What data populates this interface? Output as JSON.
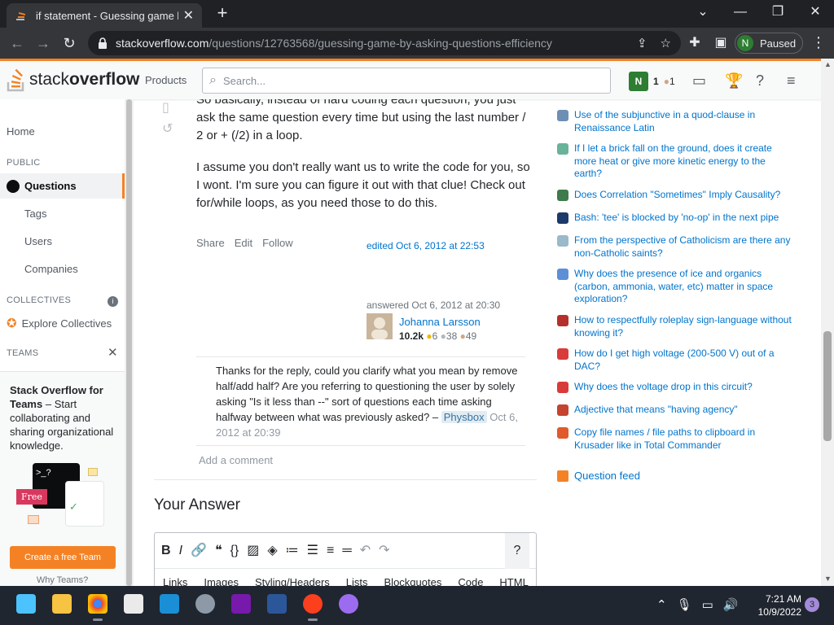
{
  "browser": {
    "tab_title": "if statement - Guessing game by",
    "url_host": "stackoverflow.com",
    "url_path": "/questions/12763568/guessing-game-by-asking-questions-efficiency",
    "profile_initial": "N",
    "profile_status": "Paused"
  },
  "so_header": {
    "logo_light": "stack",
    "logo_bold": "overflow",
    "products": "Products",
    "search_placeholder": "Search...",
    "user_initial": "N",
    "reputation": "1",
    "bronze": "1"
  },
  "leftnav": {
    "home": "Home",
    "public": "PUBLIC",
    "questions": "Questions",
    "tags": "Tags",
    "users": "Users",
    "companies": "Companies",
    "collectives": "COLLECTIVES",
    "explore_collectives": "Explore Collectives",
    "teams": "TEAMS",
    "teams_title": "Stack Overflow for Teams",
    "teams_desc": " – Start collaborating and sharing organizational knowledge.",
    "free_badge": "Free",
    "create_team": "Create a free Team",
    "why_teams": "Why Teams?"
  },
  "answer": {
    "para1": "So basically, instead of hard coding each question, you just ask the same question every time but using the last number / 2 or + (/2) in a loop.",
    "para2": "I assume you don't really want us to write the code for you, so I wont. I'm sure you can figure it out with that clue! Check out for/while loops, as you need those to do this.",
    "share": "Share",
    "edit": "Edit",
    "follow": "Follow",
    "edited": "edited Oct 6, 2012 at 22:53",
    "answered": "answered Oct 6, 2012 at 20:30",
    "user_name": "Johanna Larsson",
    "user_rep": "10.2k",
    "gold": "6",
    "silver": "38",
    "bronze": "49"
  },
  "comment": {
    "text": "Thanks for the reply, could you clarify what you mean by remove half/add half? Are you referring to questioning the user by solely asking \"Is it less than --\" sort of questions each time asking halfway between what was previously asked? – ",
    "author": "Physbox",
    "date": "Oct 6, 2012 at 20:39"
  },
  "add_comment": "Add a comment",
  "your_answer": "Your Answer",
  "editor_tabs": [
    "Links",
    "Images",
    "Styling/Headers",
    "Lists",
    "Blockquotes",
    "Code",
    "HTML"
  ],
  "hot_questions": [
    {
      "text": "Use of the subjunctive in a quod-clause in Renaissance Latin",
      "color": "#6d8fb3"
    },
    {
      "text": "If I let a brick fall on the ground, does it create more heat or give more kinetic energy to the earth?",
      "color": "#69b39a"
    },
    {
      "text": "Does Correlation \"Sometimes\" Imply Causality?",
      "color": "#3e7a4b"
    },
    {
      "text": "Bash: 'tee' is blocked by 'no-op' in the next pipe",
      "color": "#1b3a6b"
    },
    {
      "text": "From the perspective of Catholicism are there any non-Catholic saints?",
      "color": "#9ab9c9"
    },
    {
      "text": "Why does the presence of ice and organics (carbon, ammonia, water, etc) matter in space exploration?",
      "color": "#5c8fd6"
    },
    {
      "text": "How to respectfully roleplay sign-language without knowing it?",
      "color": "#b5302b"
    },
    {
      "text": "How do I get high voltage (200-500 V) out of a DAC?",
      "color": "#d93b3b"
    },
    {
      "text": "Why does the voltage drop in this circuit?",
      "color": "#d93b3b"
    },
    {
      "text": "Adjective that means \"having agency\"",
      "color": "#c4442f"
    },
    {
      "text": "Copy file names / file paths to clipboard in Krusader like in Total Commander",
      "color": "#e05a2b"
    }
  ],
  "question_feed": "Question feed",
  "taskbar": {
    "time": "7:21 AM",
    "date": "10/9/2022",
    "notifications": "3"
  },
  "colors": {
    "so_orange": "#f48225",
    "link_blue": "#0074cc"
  }
}
